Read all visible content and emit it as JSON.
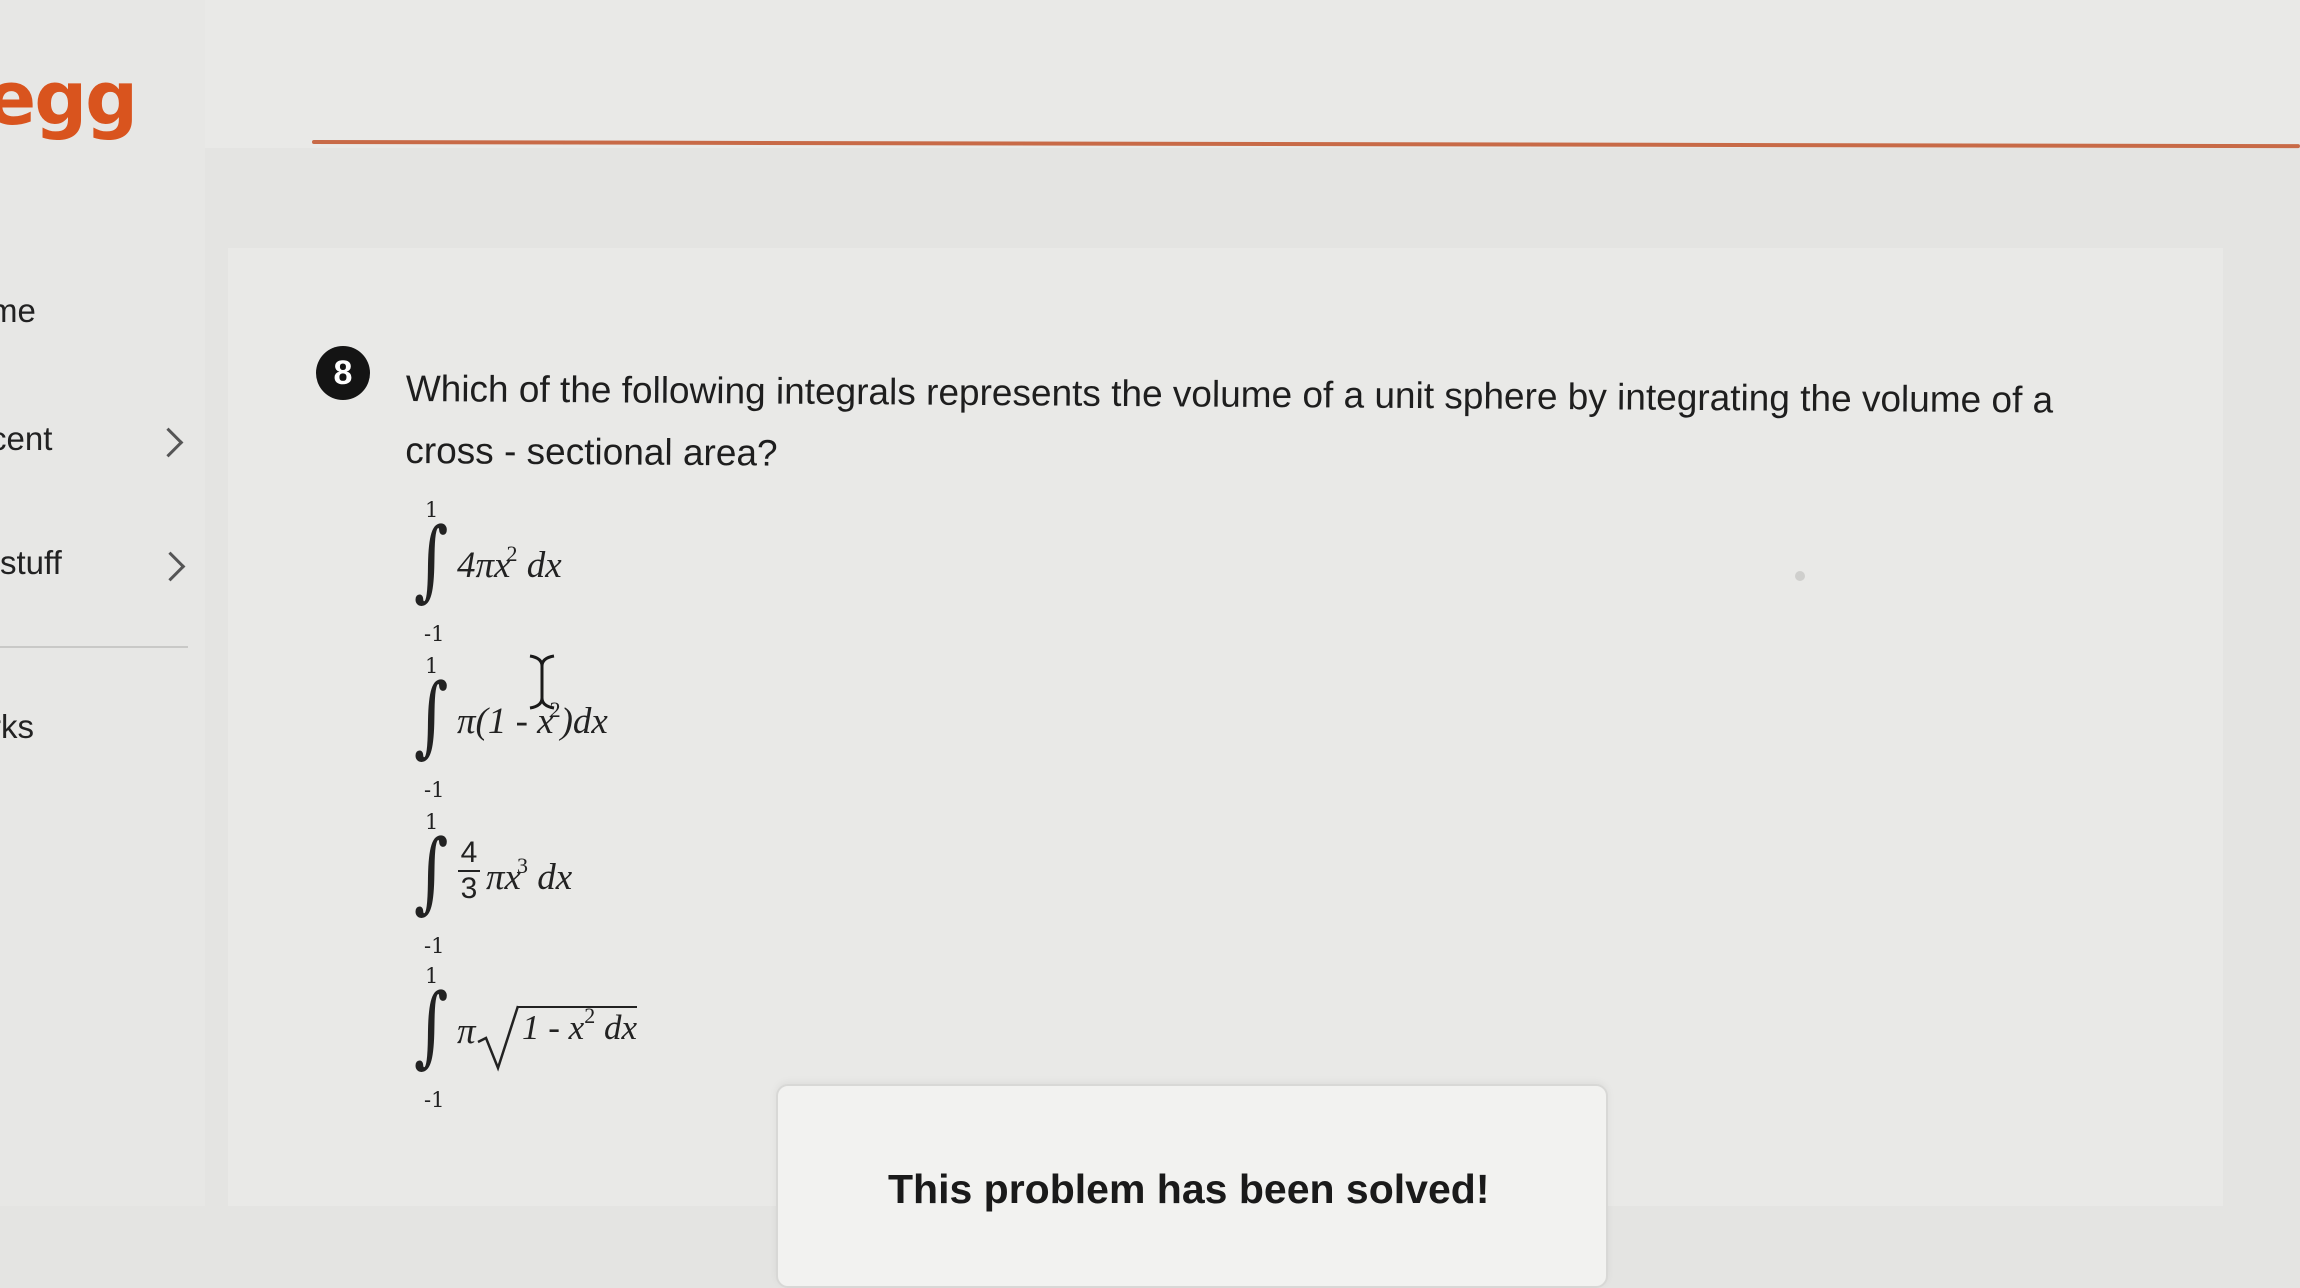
{
  "app": {
    "logo_text": "egg",
    "brand_color": "#d9541e"
  },
  "sidebar": {
    "items": [
      {
        "label": "me",
        "has_chevron": false
      },
      {
        "label": "cent",
        "has_chevron": true
      },
      {
        "label": "stuff",
        "has_chevron": true
      },
      {
        "label": "rks",
        "has_chevron": false
      }
    ]
  },
  "question": {
    "step_number": "8",
    "text": "Which of the following integrals represents the volume of a unit sphere by integrating the volume of a cross - sectional area?",
    "options": [
      {
        "upper": "1",
        "lower": "-1",
        "coef": "4πx",
        "power": "2",
        "tail": "dx"
      },
      {
        "upper": "1",
        "lower": "-1",
        "coef": "π(1 - x",
        "power": "2",
        "tail": ")dx"
      },
      {
        "upper": "1",
        "lower": "-1",
        "frac_num": "4",
        "frac_den": "3",
        "coef": "πx",
        "power": "3",
        "tail": "dx"
      },
      {
        "upper": "1",
        "lower": "-1",
        "coef": "π",
        "radicand": "1 - x",
        "power": "2",
        "tail": "dx"
      }
    ]
  },
  "solution_card": {
    "title": "This problem has been solved!"
  }
}
